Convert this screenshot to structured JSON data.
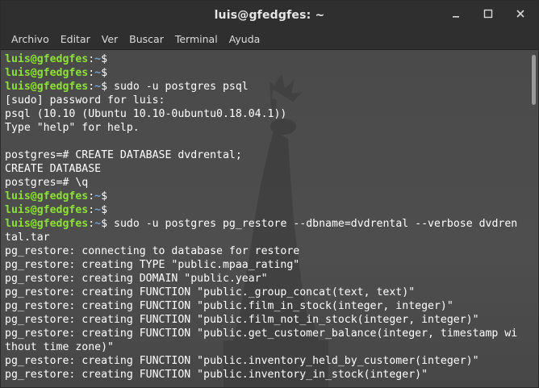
{
  "window": {
    "title": "luis@gfedgfes: ~"
  },
  "menu": [
    "Archivo",
    "Editar",
    "Ver",
    "Buscar",
    "Terminal",
    "Ayuda"
  ],
  "terminal": {
    "lines": [
      {
        "type": "prompt",
        "user": "luis@gfedgfes",
        "path": "~",
        "cmd": ""
      },
      {
        "type": "prompt",
        "user": "luis@gfedgfes",
        "path": "~",
        "cmd": ""
      },
      {
        "type": "prompt",
        "user": "luis@gfedgfes",
        "path": "~",
        "cmd": " sudo -u postgres psql"
      },
      {
        "type": "out",
        "text": "[sudo] password for luis:"
      },
      {
        "type": "out",
        "text": "psql (10.10 (Ubuntu 10.10-0ubuntu0.18.04.1))"
      },
      {
        "type": "out",
        "text": "Type \"help\" for help."
      },
      {
        "type": "out",
        "text": ""
      },
      {
        "type": "out",
        "text": "postgres=# CREATE DATABASE dvdrental;"
      },
      {
        "type": "out",
        "text": "CREATE DATABASE"
      },
      {
        "type": "out",
        "text": "postgres=# \\q"
      },
      {
        "type": "prompt",
        "user": "luis@gfedgfes",
        "path": "~",
        "cmd": ""
      },
      {
        "type": "prompt",
        "user": "luis@gfedgfes",
        "path": "~",
        "cmd": ""
      },
      {
        "type": "prompt",
        "user": "luis@gfedgfes",
        "path": "~",
        "cmd": " sudo -u postgres pg_restore --dbname=dvdrental --verbose dvdren"
      },
      {
        "type": "out",
        "text": "tal.tar"
      },
      {
        "type": "out",
        "text": "pg_restore: connecting to database for restore"
      },
      {
        "type": "out",
        "text": "pg_restore: creating TYPE \"public.mpaa_rating\""
      },
      {
        "type": "out",
        "text": "pg_restore: creating DOMAIN \"public.year\""
      },
      {
        "type": "out",
        "text": "pg_restore: creating FUNCTION \"public._group_concat(text, text)\""
      },
      {
        "type": "out",
        "text": "pg_restore: creating FUNCTION \"public.film_in_stock(integer, integer)\""
      },
      {
        "type": "out",
        "text": "pg_restore: creating FUNCTION \"public.film_not_in_stock(integer, integer)\""
      },
      {
        "type": "out",
        "text": "pg_restore: creating FUNCTION \"public.get_customer_balance(integer, timestamp wi"
      },
      {
        "type": "out",
        "text": "thout time zone)\""
      },
      {
        "type": "out",
        "text": "pg_restore: creating FUNCTION \"public.inventory_held_by_customer(integer)\""
      },
      {
        "type": "out",
        "text": "pg_restore: creating FUNCTION \"public.inventory_in_stock(integer)\""
      }
    ]
  },
  "icons": {
    "minimize": "minimize-icon",
    "maximize": "maximize-icon",
    "close": "close-icon"
  },
  "colors": {
    "prompt_user": "#8ae234",
    "prompt_path": "#729fcf",
    "text": "#ffffff",
    "background": "#4b4b4b"
  }
}
